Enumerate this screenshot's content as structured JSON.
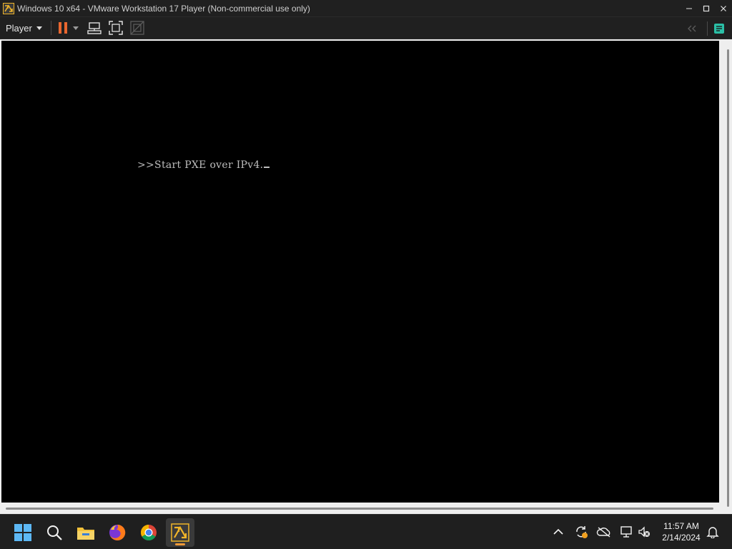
{
  "window": {
    "title": "Windows 10 x64 - VMware Workstation 17 Player (Non-commercial use only)",
    "controls": [
      "minimize-icon",
      "maximize-icon",
      "close-icon"
    ]
  },
  "toolbar": {
    "player_menu_label": "Player",
    "buttons": [
      "pause-icon",
      "dropdown-caret-icon",
      "send-ctrl-alt-del-icon",
      "fullscreen-icon",
      "unity-icon"
    ],
    "right_buttons": [
      "back-arrows-icon",
      "notes-icon"
    ],
    "accent_color": "#e9662f",
    "notes_color": "#2bbfa6"
  },
  "vm": {
    "console_text": ">>Start PXE over IPv4.",
    "background": "#000000",
    "text_color": "#bdbdbd"
  },
  "taskbar": {
    "apps": [
      {
        "name": "start-windows-icon"
      },
      {
        "name": "search-icon"
      },
      {
        "name": "file-explorer-icon"
      },
      {
        "name": "firefox-icon"
      },
      {
        "name": "chrome-icon"
      },
      {
        "name": "vmware-player-icon",
        "active": true
      }
    ],
    "tray": [
      "chevron-up-icon",
      "sync-icon",
      "onedrive-icon",
      "network-icon",
      "volume-muted-icon",
      "notification-bell-icon"
    ],
    "clock": {
      "time": "11:57 AM",
      "date": "2/14/2024"
    },
    "active_indicator_color": "#f29a38"
  }
}
